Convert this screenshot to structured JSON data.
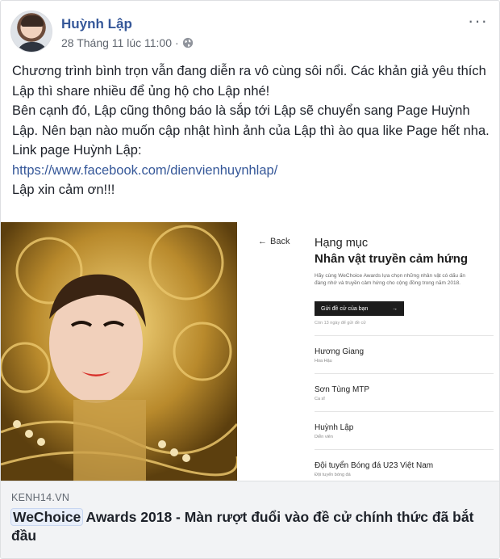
{
  "post": {
    "author": "Huỳnh Lập",
    "timestamp": "28 Tháng 11 lúc 11:00",
    "separator": "·",
    "privacy_icon": "globe-icon",
    "more_label": "···",
    "text": {
      "p1": "Chương trình bình trọn vẫn đang diễn ra vô cùng sôi nổi. Các khản giả yêu thích Lập thì share nhiều để ủng hộ cho Lập nhé!",
      "p2": "Bên cạnh đó, Lập cũng thông báo là sắp tới Lập sẽ chuyển sang Page Huỳnh Lập. Nên bạn nào muốn cập nhật hình ảnh của Lập thì ào qua like Page hết nha.",
      "p3": "Link page Huỳnh Lập:",
      "link": "https://www.facebook.com/dienvienhuynhlap/",
      "p4": "Lập xin cảm ơn!!!"
    }
  },
  "attachment": {
    "back_label": "Back",
    "category_title": "Hạng mục",
    "category_name": "Nhân vật truyền cảm hứng",
    "description": "Hãy cùng WeChoice Awards lựa chọn những nhân vật có dấu ấn đáng nhớ và truyền cảm hứng cho cộng đồng trong năm 2018.",
    "cta_label": "Gửi đề cử của bạn",
    "cta_arrow": "→",
    "days_left": "Còn 13 ngày để gửi đề cử",
    "candidates": [
      {
        "name": "Hương Giang",
        "role": "Hoa Hậu"
      },
      {
        "name": "Sơn Tùng MTP",
        "role": "Ca sĩ"
      },
      {
        "name": "Huỳnh Lập",
        "role": "Diễn viên"
      },
      {
        "name": "Đội tuyển Bóng đá U23 Việt Nam",
        "role": "Đội tuyển bóng đá"
      }
    ]
  },
  "link_preview": {
    "source": "KENH14.VN",
    "headline_highlight": "WeChoice",
    "headline_rest": " Awards 2018 - Màn rượt đuổi vào đề cử chính thức đã bắt đầu"
  },
  "colors": {
    "author_blue": "#365899",
    "meta_gray": "#616770",
    "caption_bg": "#f2f3f5"
  }
}
